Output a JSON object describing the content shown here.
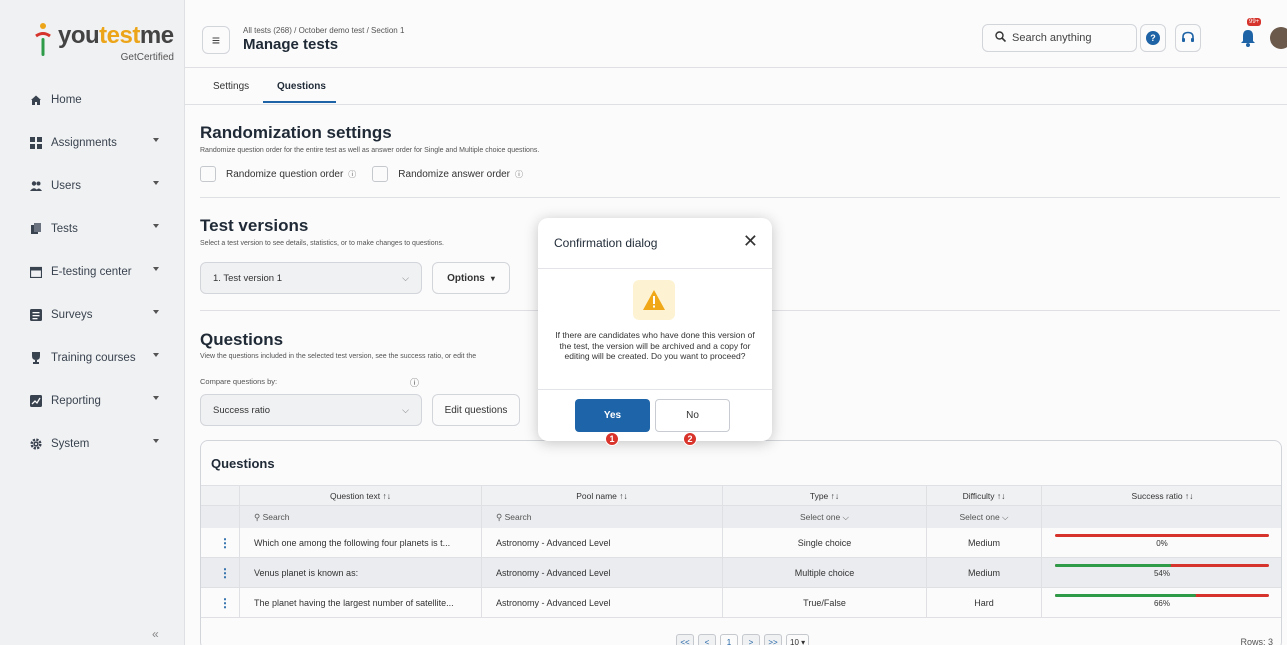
{
  "brand": {
    "name_part1": "you",
    "name_part2": "test",
    "name_part3": "me",
    "tagline": "GetCertified"
  },
  "sidebar": {
    "items": [
      {
        "label": "Home",
        "icon": "home-icon"
      },
      {
        "label": "Assignments",
        "icon": "grid-icon"
      },
      {
        "label": "Users",
        "icon": "users-icon"
      },
      {
        "label": "Tests",
        "icon": "tests-icon"
      },
      {
        "label": "E-testing center",
        "icon": "calendar-icon"
      },
      {
        "label": "Surveys",
        "icon": "survey-icon"
      },
      {
        "label": "Training courses",
        "icon": "trophy-icon"
      },
      {
        "label": "Reporting",
        "icon": "report-icon"
      },
      {
        "label": "System",
        "icon": "gear-icon"
      }
    ],
    "collapse_label": "«"
  },
  "header": {
    "breadcrumb": "All tests (268)  /  October demo test  /  Section 1",
    "title": "Manage tests",
    "search_placeholder": "Search anything",
    "notification_count": "99+"
  },
  "tabs": [
    {
      "label": "Settings"
    },
    {
      "label": "Questions"
    }
  ],
  "randomization": {
    "title": "Randomization settings",
    "description": "Randomize question order for the entire test as well as answer order for Single and Multiple choice questions.",
    "opt_question": "Randomize question order",
    "opt_answer": "Randomize answer order"
  },
  "versions": {
    "title": "Test versions",
    "description": "Select a test version to see details, statistics, or to make changes to questions.",
    "selected": "1. Test version 1",
    "options_label": "Options"
  },
  "questions_section": {
    "title": "Questions",
    "description": "View the questions included in the selected test version, see the success ratio, or edit the",
    "compare_label": "Compare questions by:",
    "compare_value": "Success ratio",
    "edit_label": "Edit questions"
  },
  "table": {
    "title": "Questions",
    "headers": [
      "Question text ↑↓",
      "Pool name ↑↓",
      "Type ↑↓",
      "Difficulty ↑↓",
      "Success ratio ↑↓"
    ],
    "filters": [
      "Search",
      "Search",
      "Select one",
      "Select one"
    ],
    "rows": [
      {
        "question": "Which one among the following four planets is t...",
        "pool": "Astronomy - Advanced Level",
        "type": "Single choice",
        "difficulty": "Medium",
        "success": 0,
        "success_label": "0%"
      },
      {
        "question": "Venus planet is known as:",
        "pool": "Astronomy - Advanced Level",
        "type": "Multiple choice",
        "difficulty": "Medium",
        "success": 54,
        "success_label": "54%"
      },
      {
        "question": "The planet having the largest number of satellite...",
        "pool": "Astronomy - Advanced Level",
        "type": "True/False",
        "difficulty": "Hard",
        "success": 66,
        "success_label": "66%"
      }
    ],
    "pager": {
      "first": "<<",
      "prev": "<",
      "page": "1",
      "next": ">",
      "last": ">>",
      "page_size": "10"
    },
    "rows_count": "Rows: 3"
  },
  "dialog": {
    "title": "Confirmation dialog",
    "message": "If there are candidates who have done this version of the test, the version will be archived and a copy for editing will be created. Do you want to proceed?",
    "yes_label": "Yes",
    "no_label": "No",
    "marker1": "1",
    "marker2": "2"
  },
  "colors": {
    "accent": "#1e64a8",
    "danger": "#d9342b",
    "success": "#2e9e4a",
    "warning": "#f0a818"
  }
}
